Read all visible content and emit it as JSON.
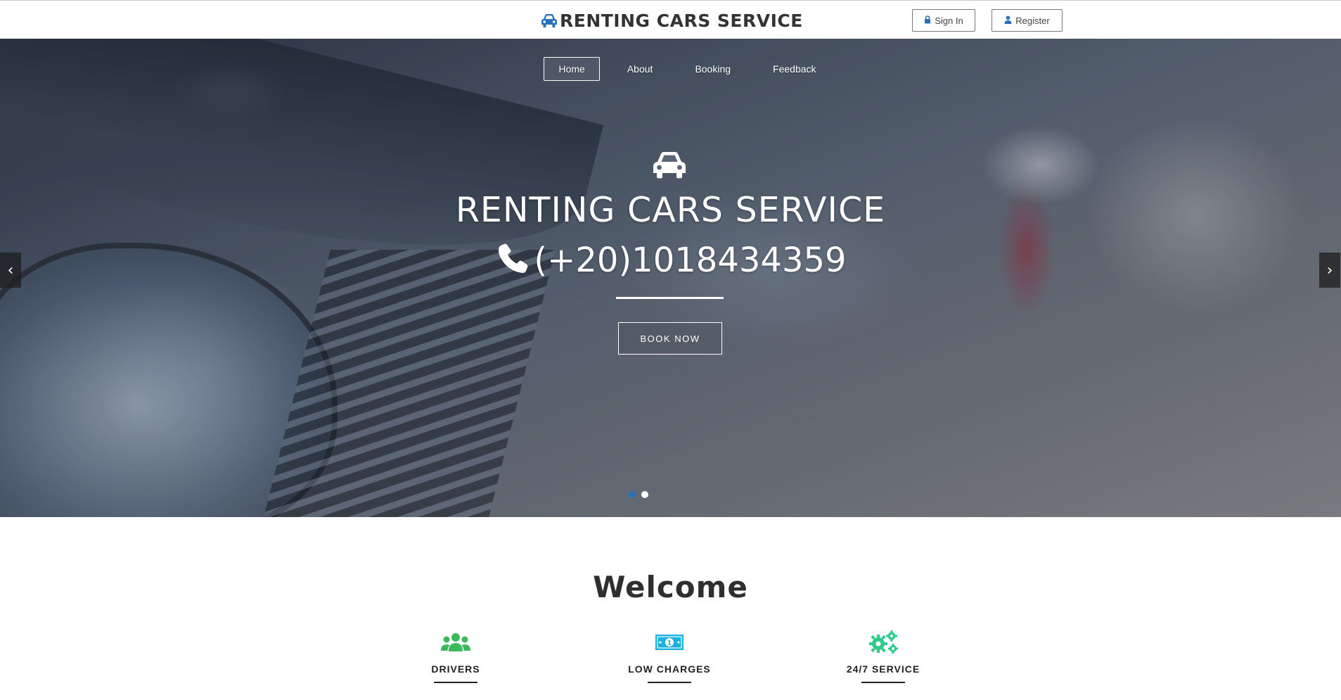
{
  "header": {
    "brand_title": "RENTING CARS SERVICE",
    "brand_icon": "car-icon",
    "signin_label": "Sign In",
    "register_label": "Register"
  },
  "nav": {
    "items": [
      {
        "label": "Home",
        "active": true
      },
      {
        "label": "About",
        "active": false
      },
      {
        "label": "Booking",
        "active": false
      },
      {
        "label": "Feedback",
        "active": false
      }
    ]
  },
  "hero": {
    "title": "RENTING CARS SERVICE",
    "phone": "(+20)1018434359",
    "cta_label": "BOOK NOW",
    "prev_label": "‹",
    "next_label": "›",
    "slide_count": 2,
    "active_slide": 1
  },
  "welcome": {
    "heading": "Welcome",
    "features": [
      {
        "label": "DRIVERS",
        "icon": "users-icon",
        "color": "#3cb95b"
      },
      {
        "label": "LOW CHARGES",
        "icon": "money-icon",
        "color": "#1ab3e0"
      },
      {
        "label": "24/7 SERVICE",
        "icon": "gears-icon",
        "color": "#2ecc8a"
      }
    ]
  },
  "colors": {
    "brand_icon": "#2a6fba",
    "active_dot": "#2a6fba"
  }
}
